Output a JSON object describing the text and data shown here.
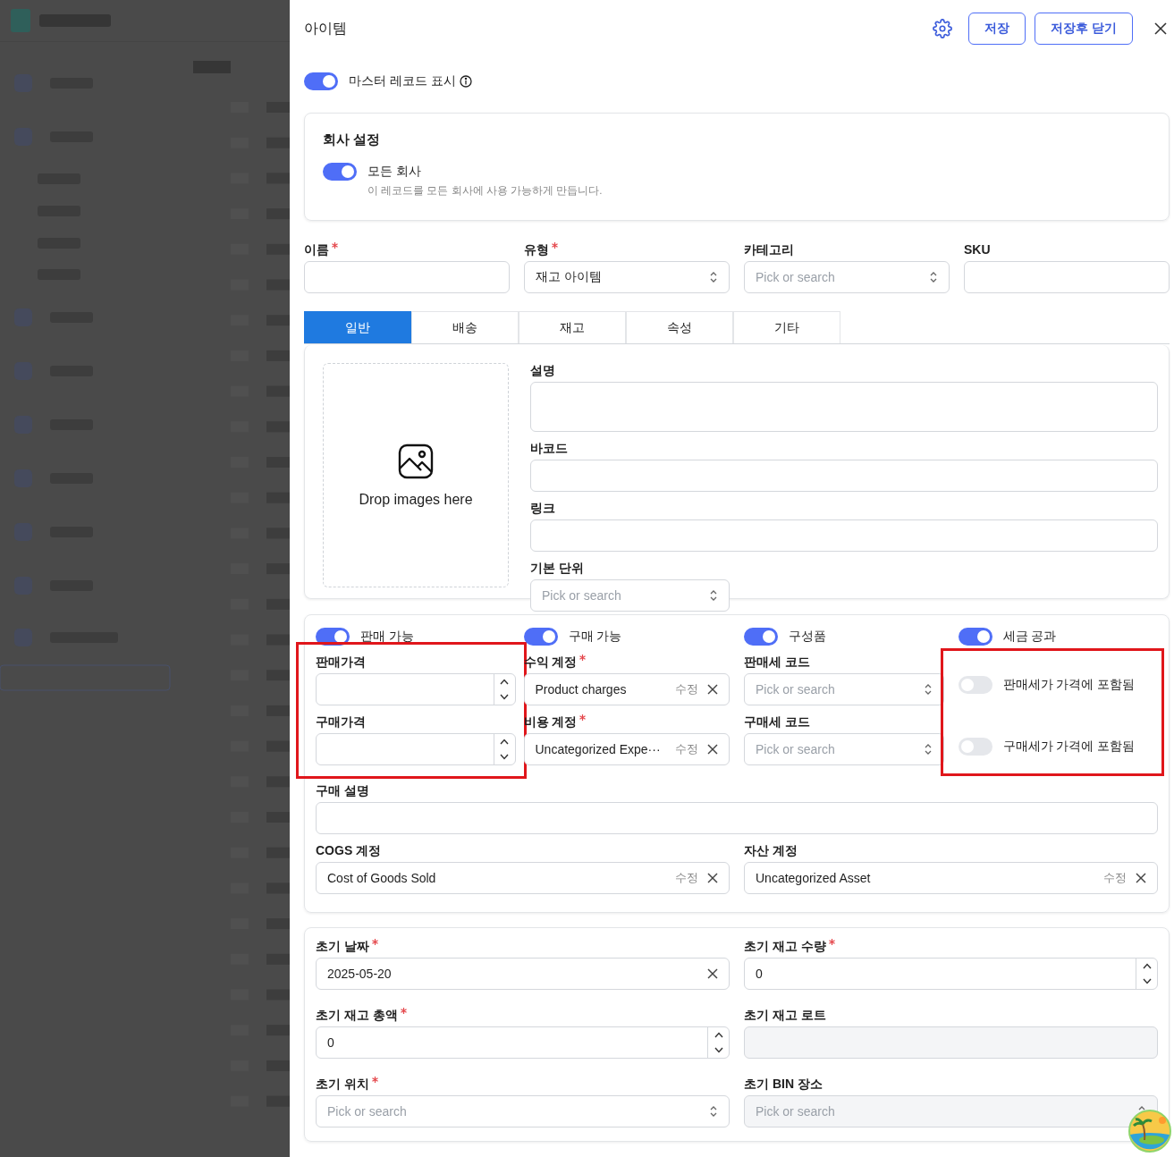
{
  "header": {
    "title": "아이템",
    "buttons": [
      {
        "label": "저장"
      },
      {
        "label": "저장후 닫기"
      }
    ]
  },
  "master_toggle": {
    "label": "마스터 레코드 표시",
    "on": true
  },
  "company_settings": {
    "title": "회사 설정",
    "toggle": {
      "label": "모든 회사",
      "on": true
    },
    "description": "이 레코드를 모든 회사에 사용 가능하게 만듭니다."
  },
  "main_fields": [
    {
      "label": "이름",
      "required": true,
      "kind": "text"
    },
    {
      "label": "유형",
      "required": true,
      "kind": "select",
      "value": "재고 아이템"
    },
    {
      "label": "카테고리",
      "kind": "select",
      "placeholder": "Pick or search"
    },
    {
      "label": "SKU",
      "kind": "text"
    }
  ],
  "tabs": [
    {
      "label": "일반",
      "selected": true
    },
    {
      "label": "배송",
      "selected": false
    },
    {
      "label": "재고",
      "selected": false
    },
    {
      "label": "속성",
      "selected": false
    },
    {
      "label": "기타",
      "selected": false
    }
  ],
  "general": {
    "dropzone": {
      "text": "Drop images here"
    },
    "fields": [
      {
        "label": "설명",
        "kind": "textarea"
      },
      {
        "label": "바코드",
        "kind": "text"
      },
      {
        "label": "링크",
        "kind": "text"
      },
      {
        "label": "기본 단위",
        "kind": "select",
        "placeholder": "Pick or search"
      }
    ]
  },
  "trade": {
    "columns": [
      {
        "toggle": {
          "label": "판매 가능",
          "on": true
        },
        "highlighted": true,
        "fields": [
          {
            "label": "판매가격",
            "kind": "number"
          },
          {
            "label": "구매가격",
            "kind": "number"
          }
        ]
      },
      {
        "toggle": {
          "label": "구매 가능",
          "on": true
        },
        "fields": [
          {
            "label": "수익 계정",
            "required": true,
            "kind": "account",
            "value": "Product charges",
            "edit_label": "수정"
          },
          {
            "label": "비용 계정",
            "required": true,
            "kind": "account",
            "value": "Uncategorized Expe···",
            "edit_label": "수정"
          }
        ]
      },
      {
        "toggle": {
          "label": "구성품",
          "on": true
        },
        "fields": [
          {
            "label": "판매세 코드",
            "kind": "select",
            "placeholder": "Pick or search"
          },
          {
            "label": "구매세 코드",
            "kind": "select",
            "placeholder": "Pick or search"
          }
        ]
      },
      {
        "toggle": {
          "label": "세금 공과",
          "on": true
        },
        "highlighted": true,
        "fields": [
          {
            "label": "판매세가 가격에 포함됨",
            "kind": "switch",
            "on": false
          },
          {
            "label": "구매세가 가격에 포함됨",
            "kind": "switch",
            "on": false
          }
        ]
      }
    ],
    "purchase_description": {
      "label": "구매 설명",
      "kind": "text"
    },
    "accounts": [
      {
        "label": "COGS 계정",
        "kind": "account",
        "value": "Cost of Goods Sold",
        "edit_label": "수정"
      },
      {
        "label": "자산 계정",
        "kind": "account",
        "value": "Uncategorized Asset",
        "edit_label": "수정"
      }
    ]
  },
  "initial_stock": {
    "fields": [
      {
        "label": "초기 날짜",
        "required": true,
        "kind": "date",
        "value": "2025-05-20"
      },
      {
        "label": "초기 재고 수량",
        "required": true,
        "kind": "number",
        "value": "0"
      },
      {
        "label": "초기 재고 총액",
        "required": true,
        "kind": "number",
        "value": "0"
      },
      {
        "label": "초기 재고 로트",
        "disabled": true,
        "kind": "text"
      },
      {
        "label": "초기 위치",
        "required": true,
        "kind": "select",
        "placeholder": "Pick or search"
      },
      {
        "label": "초기 BIN 장소",
        "disabled": true,
        "kind": "select",
        "placeholder": "Pick or search"
      }
    ]
  }
}
